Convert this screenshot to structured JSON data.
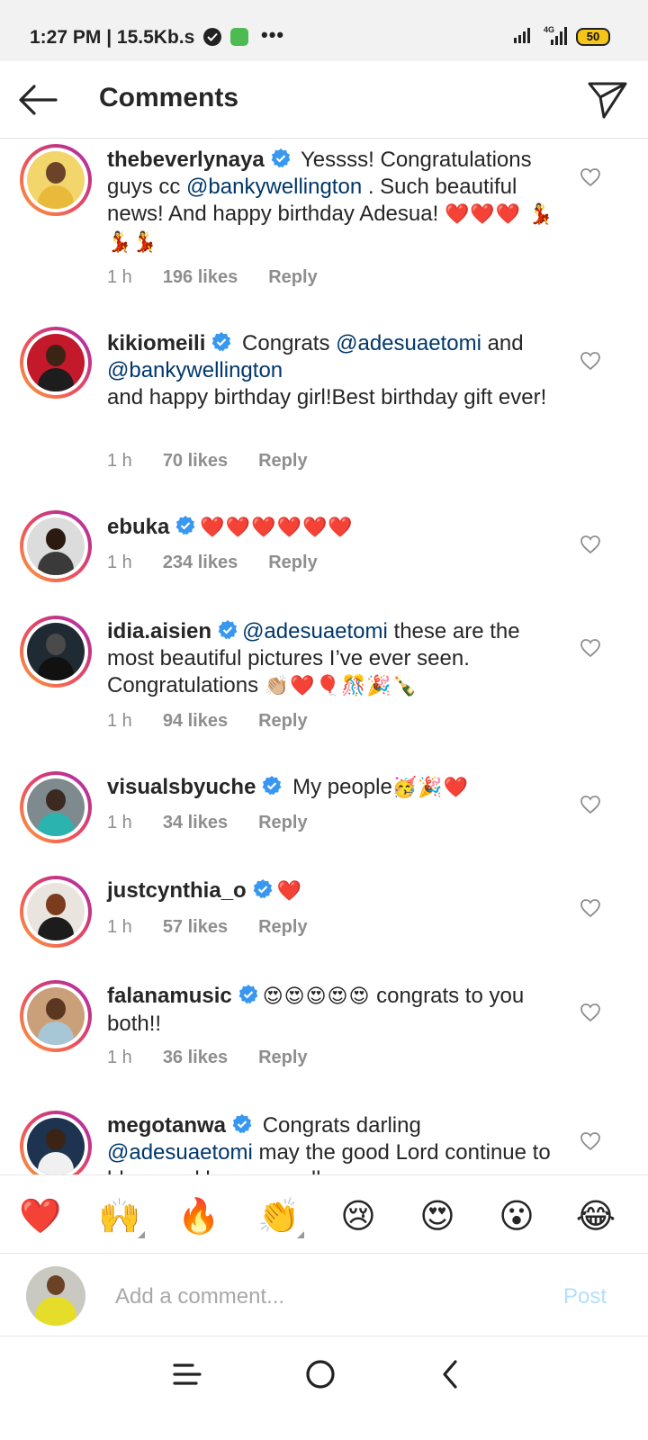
{
  "status_bar": {
    "time": "1:27 PM | 15.5Kb.s",
    "dots": "•••",
    "network": "4G",
    "battery": "50"
  },
  "header": {
    "title": "Comments"
  },
  "colors": {
    "mention": "#00376b",
    "verified": "#3897f0",
    "meta_text": "#8e8e8e",
    "post_disabled": "#b2dffc"
  },
  "comments": [
    {
      "username": "thebeverlynaya",
      "text_before": " Yessss! Congratulations guys cc ",
      "mention": "@bankywellington",
      "text_after": " . Such beautiful news! And happy birthday Adesua! ",
      "emoji": "❤️❤️❤️ 💃💃💃",
      "time": "1 h",
      "likes": "196 likes",
      "reply": "Reply"
    },
    {
      "username": "kikiomeili",
      "text_before": " Congrats ",
      "mention": "@adesuaetomi",
      "text_mid": " and ",
      "mention2": "@bankywellington",
      "text_after": "and happy birthday girl!Best birthday gift ever!",
      "time": "1 h",
      "likes": "70 likes",
      "reply": "Reply"
    },
    {
      "username": "ebuka",
      "emoji": "❤️❤️❤️❤️❤️❤️",
      "time": "1 h",
      "likes": "234 likes",
      "reply": "Reply"
    },
    {
      "username": "idia.aisien",
      "mention": "@adesuaetomi",
      "text_after": " these are the most beautiful pictures I’ve ever seen. Congratulations ",
      "emoji": "👏🏼❤️🎈🎊🎉🍾",
      "time": "1 h",
      "likes": "94 likes",
      "reply": "Reply"
    },
    {
      "username": "visualsbyuche",
      "text_after": " My people",
      "emoji": "🥳🎉❤️",
      "time": "1 h",
      "likes": "34 likes",
      "reply": "Reply"
    },
    {
      "username": "justcynthia_o",
      "emoji": "❤️",
      "time": "1 h",
      "likes": "57 likes",
      "reply": "Reply"
    },
    {
      "username": "falanamusic",
      "emoji": "😍😍😍😍😍",
      "text_after": " congrats to you both!!",
      "time": "1 h",
      "likes": "36 likes",
      "reply": "Reply"
    },
    {
      "username": "megotanwa",
      "text_before": " Congrats darling ",
      "mention": "@adesuaetomi",
      "text_after": " may the good Lord continue to bless and keep you all"
    }
  ],
  "reactions": [
    "❤️",
    "🙌",
    "🔥",
    "👏",
    "😢",
    "😍",
    "😮",
    "😂"
  ],
  "compose": {
    "placeholder": "Add a comment...",
    "post_label": "Post"
  },
  "icons": {
    "back": "back-arrow-icon",
    "send": "direct-send-icon",
    "verified": "verified-badge-icon",
    "like": "heart-outline-icon",
    "nav_menu": "menu-icon",
    "nav_home": "home-circle-icon",
    "nav_back": "back-chevron-icon"
  }
}
